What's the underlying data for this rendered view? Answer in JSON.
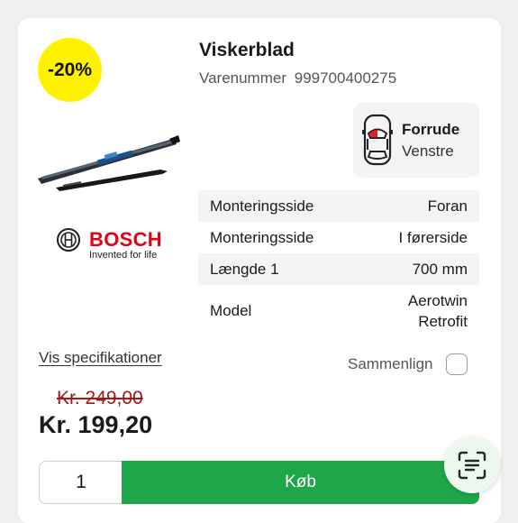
{
  "product": {
    "discount_badge": "-20%",
    "title": "Viskerblad",
    "item_number_label": "Varenummer",
    "item_number": "999700400275"
  },
  "brand": {
    "name": "BOSCH",
    "tagline": "Invented for life"
  },
  "position": {
    "primary": "Forrude",
    "secondary": "Venstre"
  },
  "specs": [
    {
      "label": "Monteringsside",
      "value": "Foran"
    },
    {
      "label": "Monteringsside",
      "value": "I førerside"
    },
    {
      "label": "Længde 1",
      "value": "700 mm"
    },
    {
      "label": "Model",
      "value": "Aerotwin Retrofit"
    }
  ],
  "links": {
    "show_specs": "Vis specifikationer",
    "compare": "Sammenlign"
  },
  "price": {
    "old": "Kr. 249,00",
    "new": "Kr. 199,20"
  },
  "cart": {
    "quantity": "1",
    "buy_label": "Køb"
  },
  "colors": {
    "badge": "#fff200",
    "buy_button": "#20a64a",
    "old_price": "#a01818",
    "brand": "#e20015"
  },
  "icons": {
    "position": "car-top-view-icon",
    "brand": "bosch-logo-icon",
    "scan": "scan-text-icon"
  }
}
